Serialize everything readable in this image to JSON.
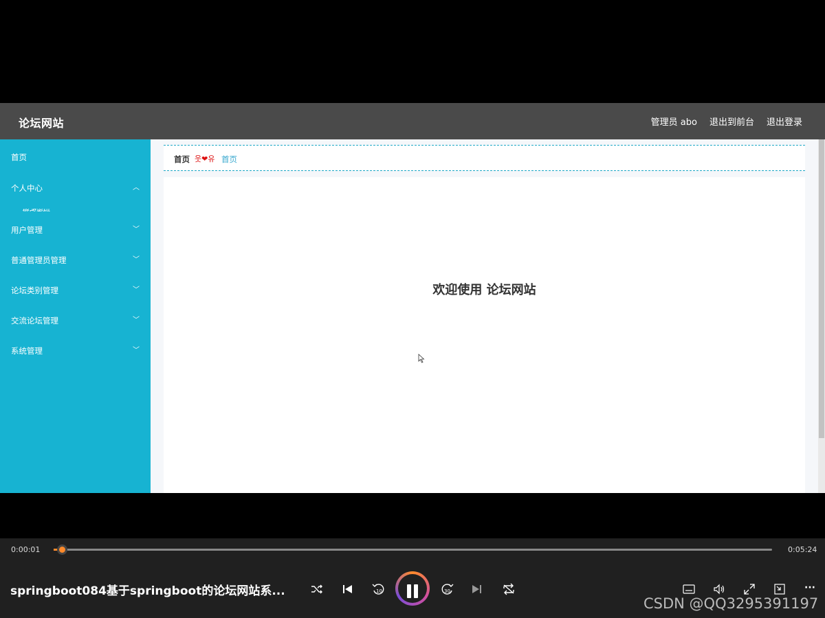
{
  "app": {
    "brand": "论坛网站",
    "topbar": {
      "user": "管理员 abo",
      "to_front": "退出到前台",
      "logout": "退出登录"
    },
    "sidebar": {
      "items": [
        {
          "label": "首页",
          "chevron": ""
        },
        {
          "label": "个人中心",
          "chevron": "^"
        },
        {
          "label": "用户管理",
          "chevron": "v"
        },
        {
          "label": "普通管理员管理",
          "chevron": "v"
        },
        {
          "label": "论坛类别管理",
          "chevron": "v"
        },
        {
          "label": "交流论坛管理",
          "chevron": "v"
        },
        {
          "label": "系统管理",
          "chevron": "v"
        }
      ],
      "submenu_peek": "修改密码"
    },
    "breadcrumb": {
      "title": "首页",
      "decoration": "웃❤유",
      "link": "首页"
    },
    "welcome": "欢迎使用 论坛网站"
  },
  "player": {
    "elapsed": "0:00:01",
    "total": "0:05:24",
    "progress_fraction": 0.003,
    "title": "springboot084基于springboot的论坛网站系...",
    "watermark": "CSDN @QQ3295391197",
    "icons": [
      "shuffle-icon",
      "previous-icon",
      "rewind-10-icon",
      "pause-icon",
      "forward-30-icon",
      "next-icon",
      "repeat-icon",
      "captions-icon",
      "volume-icon",
      "fullscreen-icon",
      "mini-player-icon",
      "more-icon"
    ],
    "accent": "#ff8a2b"
  }
}
